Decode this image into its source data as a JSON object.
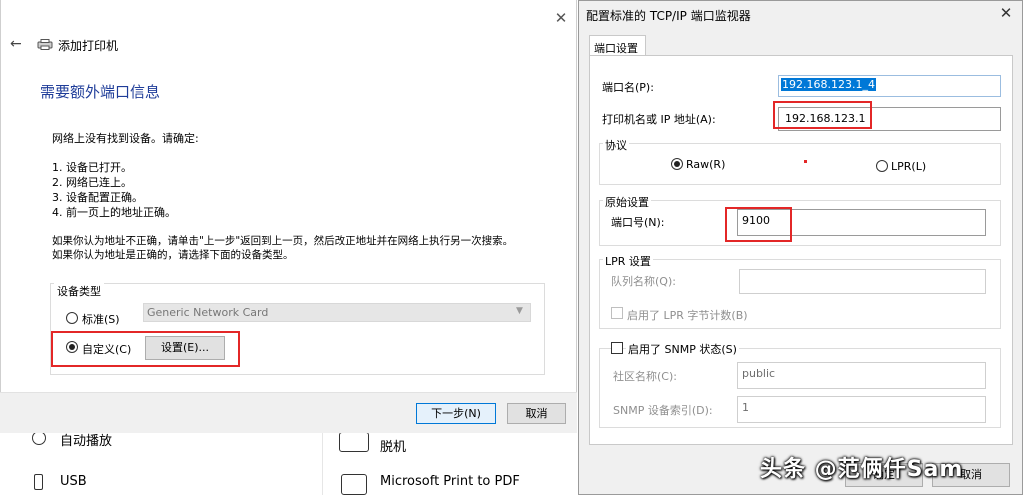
{
  "background_page": {
    "items_left": [
      {
        "icon": "autoplay-icon",
        "label": "自动播放"
      },
      {
        "icon": "usb-icon",
        "label": "USB"
      }
    ],
    "items_right": [
      {
        "icon": "fax-icon",
        "label": "脱机"
      },
      {
        "icon": "pdf-printer-icon",
        "label": "Microsoft Print to PDF"
      }
    ]
  },
  "wizard": {
    "title": "添加打印机",
    "back_icon": "←",
    "close_icon": "✕",
    "heading": "需要额外端口信息",
    "intro": "网络上没有找到设备。请确定:",
    "checklist": [
      "1.  设备已打开。",
      "2.  网络已连上。",
      "3.  设备配置正确。",
      "4.  前一页上的地址正确。"
    ],
    "advice": [
      "如果你认为地址不正确，请单击\"上一步\"返回到上一页，然后改正地址并在网络上执行另一次搜索。",
      "如果你认为地址是正确的，请选择下面的设备类型。"
    ],
    "device_type": {
      "legend": "设备类型",
      "standard_label": "标准(S)",
      "standard_selected": false,
      "standard_value": "Generic Network Card",
      "custom_label": "自定义(C)",
      "custom_selected": true,
      "settings_button": "设置(E)..."
    },
    "next_button": "下一步(N)",
    "cancel_button": "取消"
  },
  "tcp_dialog": {
    "title": "配置标准的 TCP/IP 端口监视器",
    "close_icon": "✕",
    "tab": "端口设置",
    "port_name_label": "端口名(P):",
    "port_name_value": "192.168.123.1_4",
    "ip_label": "打印机名或 IP 地址(A):",
    "ip_value": "192.168.123.1",
    "protocol": {
      "legend": "协议",
      "raw_label": "Raw(R)",
      "raw_selected": true,
      "lpr_label": "LPR(L)",
      "lpr_selected": false
    },
    "raw_settings": {
      "legend": "原始设置",
      "port_number_label": "端口号(N):",
      "port_number_value": "9100"
    },
    "lpr_settings": {
      "legend": "LPR 设置",
      "queue_name_label": "队列名称(Q):",
      "queue_name_value": "",
      "byte_count_label": "启用了 LPR 字节计数(B)",
      "byte_count_checked": false
    },
    "snmp": {
      "enabled_label": "启用了 SNMP 状态(S)",
      "enabled_checked": false,
      "community_label": "社区名称(C):",
      "community_value": "public",
      "device_index_label": "SNMP 设备索引(D):",
      "device_index_value": "1"
    },
    "ok_button": "确定",
    "cancel_button": "取消"
  },
  "watermark": "头条 @范俩仟Sam"
}
